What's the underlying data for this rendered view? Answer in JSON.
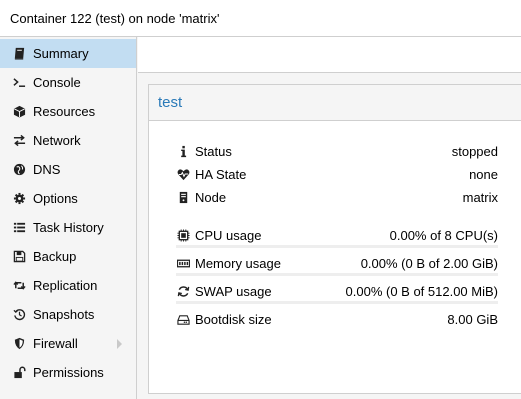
{
  "window": {
    "title": "Container 122 (test) on node 'matrix'"
  },
  "sidebar": {
    "items": [
      {
        "label": "Summary",
        "icon": "book-icon",
        "active": true
      },
      {
        "label": "Console",
        "icon": "terminal-icon"
      },
      {
        "label": "Resources",
        "icon": "cube-icon"
      },
      {
        "label": "Network",
        "icon": "exchange-icon"
      },
      {
        "label": "DNS",
        "icon": "globe-icon"
      },
      {
        "label": "Options",
        "icon": "gear-icon"
      },
      {
        "label": "Task History",
        "icon": "list-icon"
      },
      {
        "label": "Backup",
        "icon": "floppy-icon"
      },
      {
        "label": "Replication",
        "icon": "retweet-icon"
      },
      {
        "label": "Snapshots",
        "icon": "history-icon"
      },
      {
        "label": "Firewall",
        "icon": "shield-icon",
        "has_submenu": true
      },
      {
        "label": "Permissions",
        "icon": "unlock-icon"
      }
    ]
  },
  "panel": {
    "title": "test",
    "status": {
      "label": "Status",
      "value": "stopped",
      "icon": "info-icon"
    },
    "ha_state": {
      "label": "HA State",
      "value": "none",
      "icon": "heartbeat-icon"
    },
    "node": {
      "label": "Node",
      "value": "matrix",
      "icon": "server-icon"
    },
    "cpu": {
      "label": "CPU usage",
      "value": "0.00% of 8 CPU(s)",
      "icon": "cpu-icon",
      "fraction": 0
    },
    "memory": {
      "label": "Memory usage",
      "value": "0.00% (0 B of 2.00 GiB)",
      "icon": "memory-icon",
      "fraction": 0
    },
    "swap": {
      "label": "SWAP usage",
      "value": "0.00% (0 B of 512.00 MiB)",
      "icon": "refresh-icon",
      "fraction": 0
    },
    "bootdisk": {
      "label": "Bootdisk size",
      "value": "8.00 GiB",
      "icon": "hdd-icon"
    }
  },
  "colors": {
    "accent": "#2a7ab8",
    "selection": "#c2ddf2",
    "bar_track": "#eeeeee"
  }
}
